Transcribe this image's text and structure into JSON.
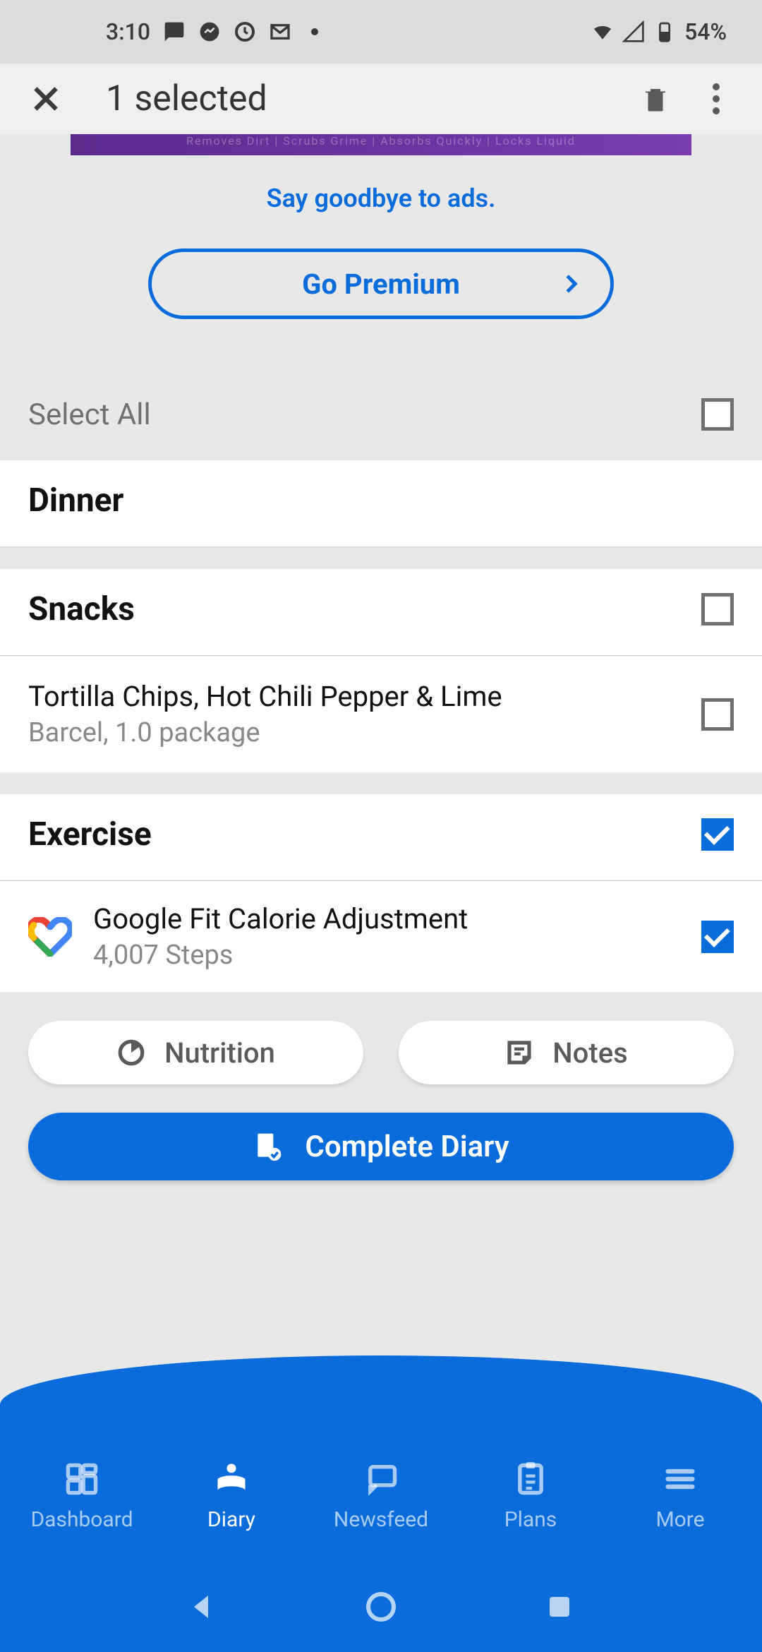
{
  "status": {
    "time": "3:10",
    "battery": "54%"
  },
  "header": {
    "title": "1 selected"
  },
  "ads": {
    "goodbye_label": "Say goodbye to ads.",
    "premium_label": "Go Premium"
  },
  "select_all": {
    "label": "Select All",
    "checked": false
  },
  "sections": {
    "dinner": {
      "title": "Dinner"
    },
    "snacks": {
      "title": "Snacks",
      "checked": false,
      "items": [
        {
          "title": "Tortilla Chips, Hot Chili Pepper & Lime",
          "sub": "Barcel, 1.0 package",
          "checked": false
        }
      ]
    },
    "exercise": {
      "title": "Exercise",
      "checked": true,
      "items": [
        {
          "title": "Google Fit Calorie Adjustment",
          "sub": "4,007 Steps",
          "checked": true
        }
      ]
    }
  },
  "actions": {
    "nutrition": "Nutrition",
    "notes": "Notes",
    "complete": "Complete Diary"
  },
  "nav": {
    "items": [
      {
        "label": "Dashboard"
      },
      {
        "label": "Diary"
      },
      {
        "label": "Newsfeed"
      },
      {
        "label": "Plans"
      },
      {
        "label": "More"
      }
    ],
    "active_index": 1
  }
}
